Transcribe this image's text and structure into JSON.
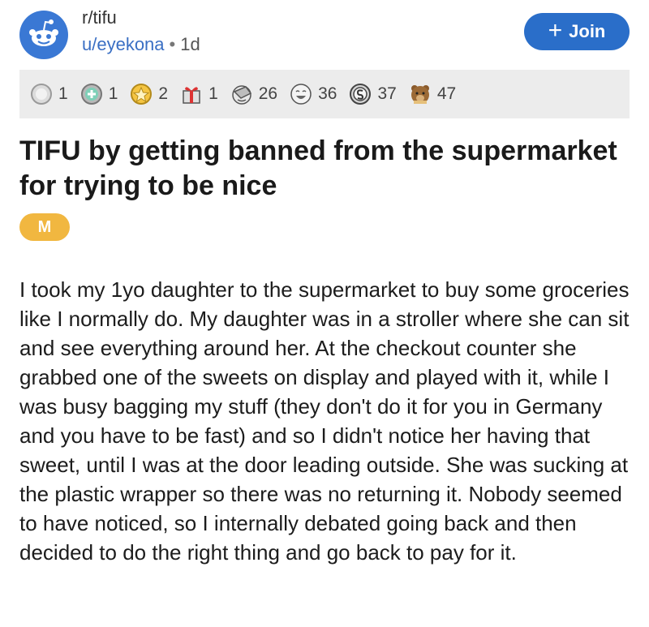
{
  "post": {
    "subreddit": "r/tifu",
    "author": "u/eyekona",
    "separator": "•",
    "age": "1d",
    "join_label": "Join",
    "join_icon": "+",
    "awards": [
      {
        "icon": "silver-award-icon",
        "count": "1"
      },
      {
        "icon": "helpful-award-icon",
        "count": "1"
      },
      {
        "icon": "gold-star-award-icon",
        "count": "2"
      },
      {
        "icon": "gift-award-icon",
        "count": "1"
      },
      {
        "icon": "facepalm-award-icon",
        "count": "26"
      },
      {
        "icon": "laughing-award-icon",
        "count": "36"
      },
      {
        "icon": "snek-award-icon",
        "count": "37"
      },
      {
        "icon": "bear-award-icon",
        "count": "47"
      }
    ],
    "title": "TIFU by getting banned from the supermarket for trying to be nice",
    "flair": "M",
    "body": "I took my 1yo daughter to the supermarket to buy some groceries like I normally do. My daughter was in a stroller where she can sit and see everything around her. At the checkout counter she grabbed one of the sweets on display and played with it, while I was busy bagging my stuff (they don't do it for you in Germany and you have to be fast) and so I didn't notice her having that sweet, until I was at the door leading outside. She was sucking at the plastic wrapper so there was no returning it. Nobody seemed to have noticed, so I internally debated going back and then decided to do the right thing and go back to pay for it."
  },
  "colors": {
    "subreddit_icon_bg": "#3a78d4",
    "user_link": "#3a6fc4",
    "join_button": "#2a6ec9",
    "awards_bar": "#ececec",
    "flair_bg": "#f1b740"
  }
}
